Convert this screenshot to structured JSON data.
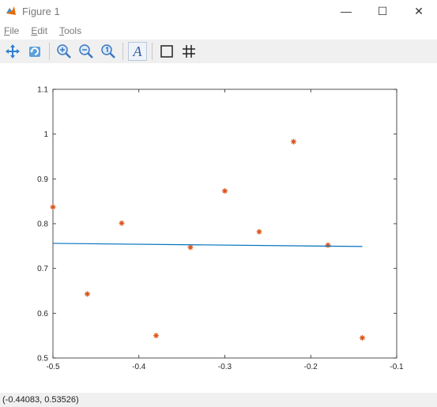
{
  "window": {
    "title": "Figure 1",
    "controls": {
      "minimize": "—",
      "maximize": "☐",
      "close": "✕"
    }
  },
  "menu": [
    {
      "label_mnemonic": "F",
      "label_rest": "ile"
    },
    {
      "label_mnemonic": "E",
      "label_rest": "dit"
    },
    {
      "label_mnemonic": "T",
      "label_rest": "ools"
    }
  ],
  "toolbar": {
    "icons": [
      "pan-icon",
      "rotate-icon",
      "zoom-in-icon",
      "zoom-out-icon",
      "zoom-reset-icon",
      "insert-text-icon",
      "box-icon",
      "grid-icon"
    ],
    "text_button_label": "A"
  },
  "status": {
    "coordinates": "(-0.44083, 0.53526)"
  },
  "colors": {
    "scatter": "#d95319",
    "line": "#0072bd",
    "axes": "#262626"
  },
  "chart_data": {
    "type": "scatter",
    "title": "",
    "xlabel": "",
    "ylabel": "",
    "xlim": [
      -0.5,
      -0.1
    ],
    "ylim": [
      0.5,
      1.1
    ],
    "xticks": [
      "-0.5",
      "-0.4",
      "-0.3",
      "-0.2",
      "-0.1"
    ],
    "yticks": [
      "0.5",
      "0.6",
      "0.7",
      "0.8",
      "0.9",
      "1",
      "1.1"
    ],
    "series": [
      {
        "type": "scatter",
        "marker": "*",
        "x": [
          -0.5,
          -0.46,
          -0.42,
          -0.38,
          -0.34,
          -0.3,
          -0.26,
          -0.22,
          -0.18,
          -0.14
        ],
        "y": [
          0.837,
          0.643,
          0.801,
          0.55,
          0.747,
          0.873,
          0.782,
          0.983,
          0.752,
          0.545
        ]
      },
      {
        "type": "line",
        "x": [
          -0.5,
          -0.14
        ],
        "y": [
          0.756,
          0.749
        ]
      }
    ]
  }
}
